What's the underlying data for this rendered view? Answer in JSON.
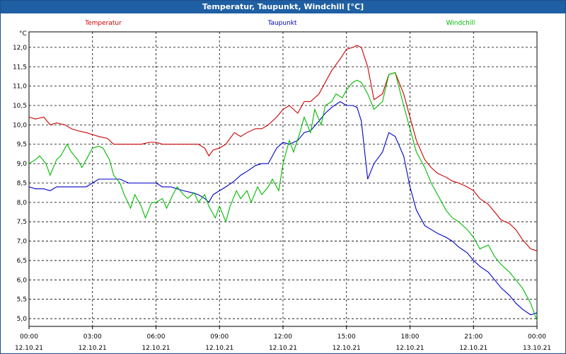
{
  "window": {
    "title": "Temperatur, Taupunkt, Windchill [°C]"
  },
  "chart_data": {
    "type": "line",
    "title": "Temperatur, Taupunkt, Windchill [°C]",
    "ylabel": "°C",
    "ylim": [
      4.8,
      12.4
    ],
    "xlim": [
      0,
      24
    ],
    "yticks": [
      "12,0",
      "11,5",
      "11,0",
      "10,5",
      "10,0",
      "9,5",
      "9,0",
      "8,5",
      "8,0",
      "7,5",
      "7,0",
      "6,5",
      "6,0",
      "5,5",
      "5,0"
    ],
    "ytick_values": [
      12.0,
      11.5,
      11.0,
      10.5,
      10.0,
      9.5,
      9.0,
      8.5,
      8.0,
      7.5,
      7.0,
      6.5,
      6.0,
      5.5,
      5.0
    ],
    "xticks": [
      {
        "time": "00:00",
        "date": "12.10.21",
        "h": 0
      },
      {
        "time": "03:00",
        "date": "12.10.21",
        "h": 3
      },
      {
        "time": "06:00",
        "date": "12.10.21",
        "h": 6
      },
      {
        "time": "09:00",
        "date": "12.10.21",
        "h": 9
      },
      {
        "time": "12:00",
        "date": "12.10.21",
        "h": 12
      },
      {
        "time": "15:00",
        "date": "12.10.21",
        "h": 15
      },
      {
        "time": "18:00",
        "date": "12.10.21",
        "h": 18
      },
      {
        "time": "21:00",
        "date": "12.10.21",
        "h": 21
      },
      {
        "time": "00:00",
        "date": "13.10.21",
        "h": 24
      }
    ],
    "grid": true,
    "legend": "top",
    "series": [
      {
        "name": "Temperatur",
        "color": "#cc0000",
        "x": [
          0,
          0.3,
          0.7,
          1,
          1.3,
          1.7,
          2,
          2.3,
          2.7,
          3,
          3.3,
          3.7,
          4,
          4.3,
          4.7,
          5,
          5.3,
          5.7,
          6,
          6.3,
          6.7,
          7,
          7.3,
          7.7,
          8,
          8.3,
          8.5,
          8.7,
          9,
          9.3,
          9.7,
          10,
          10.3,
          10.7,
          11,
          11.3,
          11.7,
          12,
          12.3,
          12.7,
          13,
          13.3,
          13.7,
          14,
          14.3,
          14.7,
          15,
          15.3,
          15.5,
          15.7,
          16,
          16.3,
          16.7,
          17,
          17.3,
          17.7,
          18,
          18.3,
          18.7,
          19,
          19.3,
          19.7,
          20,
          20.3,
          20.7,
          21,
          21.3,
          21.7,
          22,
          22.3,
          22.7,
          23,
          23.3,
          23.7,
          24
        ],
        "values": [
          10.2,
          10.15,
          10.2,
          10.0,
          10.05,
          10.0,
          9.9,
          9.85,
          9.8,
          9.75,
          9.7,
          9.65,
          9.5,
          9.5,
          9.5,
          9.5,
          9.5,
          9.55,
          9.55,
          9.5,
          9.5,
          9.5,
          9.5,
          9.5,
          9.5,
          9.4,
          9.2,
          9.35,
          9.4,
          9.5,
          9.8,
          9.7,
          9.8,
          9.9,
          9.9,
          10.0,
          10.2,
          10.4,
          10.5,
          10.3,
          10.6,
          10.6,
          10.8,
          11.1,
          11.4,
          11.7,
          11.95,
          12.0,
          12.05,
          12.0,
          11.5,
          10.65,
          10.8,
          11.3,
          11.35,
          10.8,
          10.2,
          9.6,
          9.1,
          8.9,
          8.75,
          8.65,
          8.55,
          8.5,
          8.4,
          8.3,
          8.1,
          7.95,
          7.75,
          7.55,
          7.45,
          7.3,
          7.05,
          6.8,
          6.75
        ]
      },
      {
        "name": "Taupunkt",
        "color": "#0000cc",
        "x": [
          0,
          0.3,
          0.7,
          1,
          1.3,
          1.7,
          2,
          2.3,
          2.7,
          3,
          3.3,
          3.7,
          4,
          4.3,
          4.7,
          5,
          5.3,
          5.7,
          6,
          6.3,
          6.7,
          7,
          7.3,
          7.7,
          8,
          8.3,
          8.5,
          8.7,
          9,
          9.3,
          9.7,
          10,
          10.3,
          10.7,
          11,
          11.3,
          11.7,
          12,
          12.3,
          12.7,
          13,
          13.3,
          13.7,
          14,
          14.3,
          14.7,
          15,
          15.3,
          15.5,
          15.7,
          16,
          16.3,
          16.7,
          17,
          17.3,
          17.7,
          18,
          18.3,
          18.7,
          19,
          19.3,
          19.7,
          20,
          20.3,
          20.7,
          21,
          21.3,
          21.7,
          22,
          22.3,
          22.7,
          23,
          23.3,
          23.7,
          24
        ],
        "values": [
          8.4,
          8.35,
          8.35,
          8.3,
          8.4,
          8.4,
          8.4,
          8.4,
          8.4,
          8.5,
          8.6,
          8.6,
          8.6,
          8.6,
          8.5,
          8.5,
          8.5,
          8.5,
          8.5,
          8.4,
          8.4,
          8.35,
          8.3,
          8.25,
          8.2,
          8.1,
          8.0,
          8.2,
          8.3,
          8.4,
          8.55,
          8.7,
          8.8,
          8.95,
          9.0,
          9.0,
          9.4,
          9.55,
          9.5,
          9.6,
          9.8,
          9.85,
          10.1,
          10.3,
          10.45,
          10.6,
          10.5,
          10.5,
          10.45,
          10.1,
          8.6,
          9.0,
          9.3,
          9.8,
          9.7,
          9.2,
          8.4,
          7.8,
          7.4,
          7.3,
          7.2,
          7.1,
          7.0,
          6.85,
          6.7,
          6.5,
          6.35,
          6.2,
          6.0,
          5.8,
          5.6,
          5.4,
          5.25,
          5.1,
          5.15
        ]
      },
      {
        "name": "Windchill",
        "color": "#00bb00",
        "x": [
          0,
          0.3,
          0.5,
          0.8,
          1,
          1.3,
          1.5,
          1.8,
          2,
          2.3,
          2.5,
          2.8,
          3,
          3.3,
          3.5,
          3.8,
          4,
          4.3,
          4.5,
          4.8,
          5,
          5.3,
          5.5,
          5.8,
          6,
          6.3,
          6.5,
          6.8,
          7,
          7.3,
          7.5,
          7.8,
          8,
          8.3,
          8.5,
          8.8,
          9,
          9.3,
          9.5,
          9.8,
          10,
          10.3,
          10.5,
          10.8,
          11,
          11.3,
          11.5,
          11.8,
          12,
          12.3,
          12.5,
          12.8,
          13,
          13.3,
          13.5,
          13.8,
          14,
          14.3,
          14.5,
          14.8,
          15,
          15.3,
          15.5,
          15.7,
          16,
          16.3,
          16.7,
          17,
          17.3,
          17.7,
          18,
          18.3,
          18.7,
          19,
          19.3,
          19.7,
          20,
          20.3,
          20.7,
          21,
          21.3,
          21.7,
          22,
          22.3,
          22.7,
          23,
          23.3,
          23.7,
          24
        ],
        "values": [
          9.0,
          9.1,
          9.2,
          9.0,
          8.7,
          9.1,
          9.2,
          9.5,
          9.3,
          9.1,
          8.9,
          9.2,
          9.4,
          9.45,
          9.4,
          9.1,
          8.7,
          8.5,
          8.2,
          7.85,
          8.2,
          7.9,
          7.6,
          8.0,
          8.0,
          8.1,
          7.85,
          8.2,
          8.4,
          8.2,
          8.1,
          8.25,
          8.0,
          8.2,
          7.9,
          7.6,
          7.9,
          7.5,
          7.9,
          8.3,
          8.1,
          8.3,
          8.0,
          8.4,
          8.2,
          8.4,
          8.6,
          8.3,
          9.0,
          9.6,
          9.3,
          9.8,
          10.2,
          9.8,
          10.4,
          10.0,
          10.5,
          10.6,
          10.8,
          10.7,
          10.9,
          11.1,
          11.15,
          11.1,
          10.8,
          10.4,
          10.6,
          11.3,
          11.35,
          10.5,
          9.9,
          9.3,
          8.9,
          8.5,
          8.2,
          7.8,
          7.6,
          7.5,
          7.3,
          7.1,
          6.8,
          6.9,
          6.6,
          6.4,
          6.2,
          6.0,
          5.8,
          5.4,
          4.95
        ]
      }
    ]
  }
}
